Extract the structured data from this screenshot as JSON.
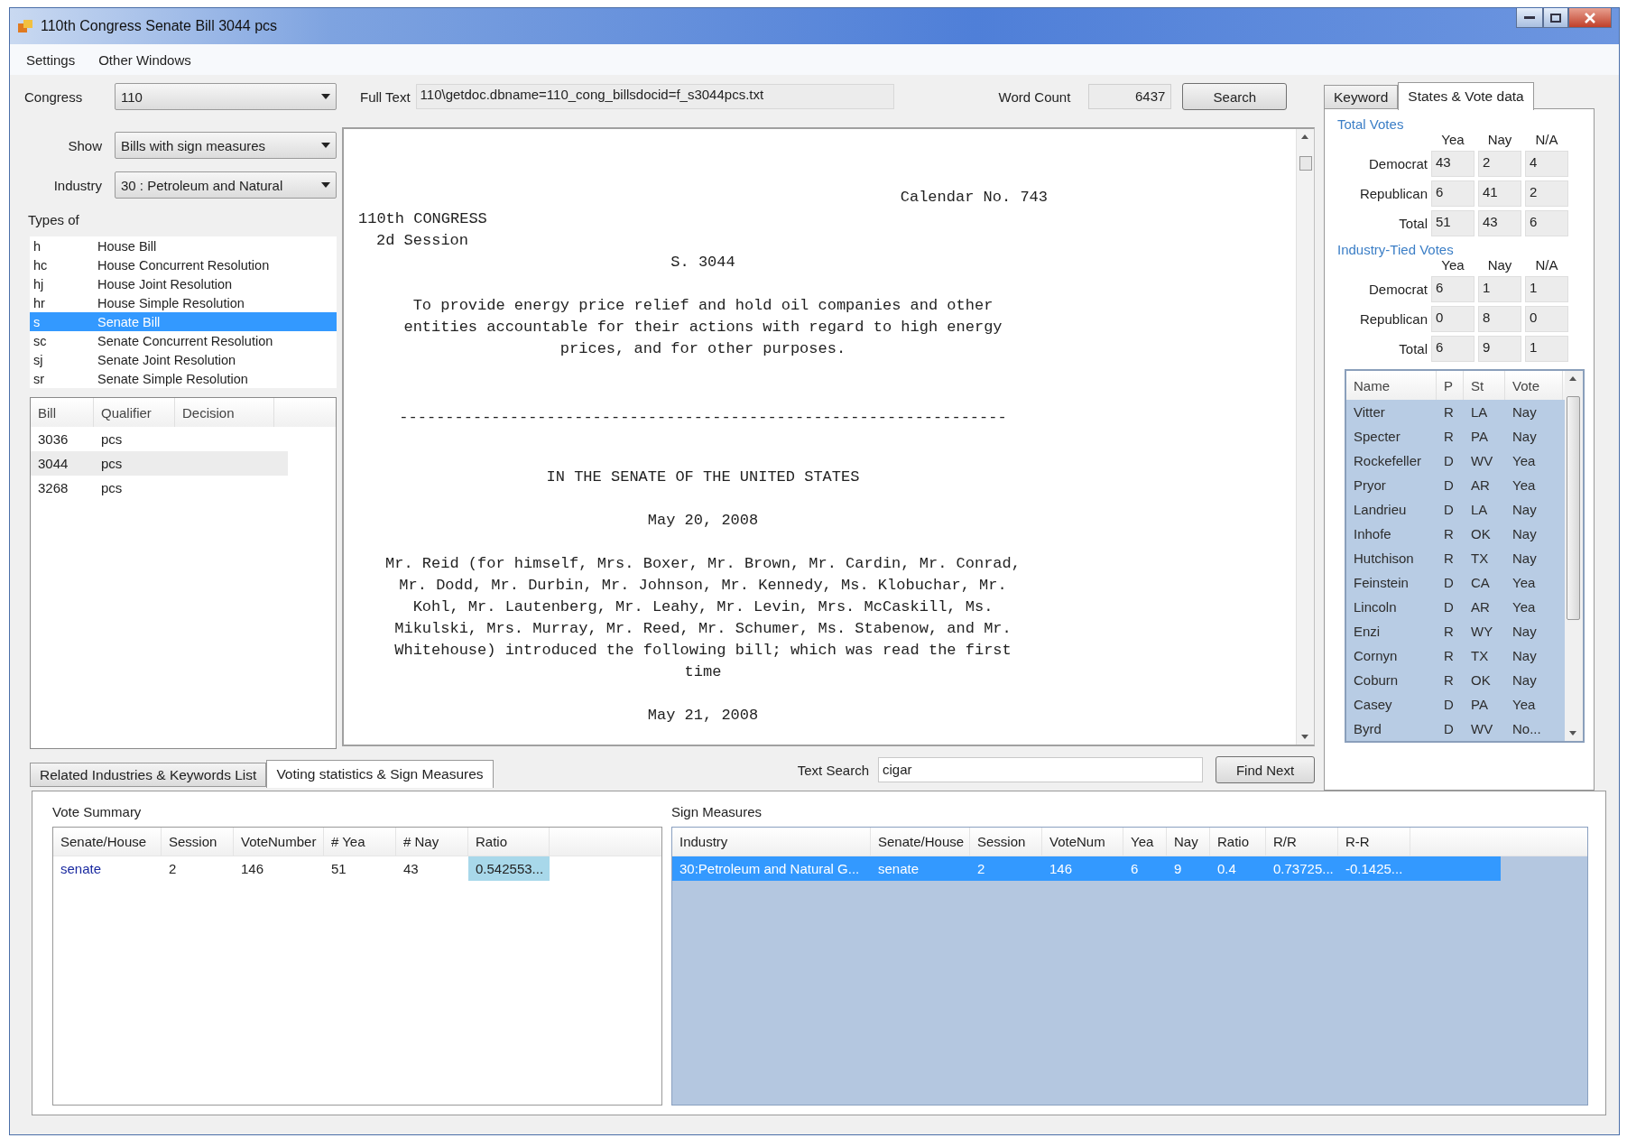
{
  "window": {
    "title": "110th Congress Senate Bill 3044 pcs"
  },
  "menu": [
    "Settings",
    "Other Windows"
  ],
  "filters": [
    {
      "label": "Congress",
      "value": "110"
    },
    {
      "label": "Show",
      "value": "Bills with sign measures"
    },
    {
      "label": "Industry",
      "value": "30 : Petroleum and Natural"
    }
  ],
  "types": {
    "label": "Types of",
    "items": [
      {
        "code": "h",
        "name": "House Bill",
        "selected": false
      },
      {
        "code": "hc",
        "name": "House Concurrent Resolution",
        "selected": false
      },
      {
        "code": "hj",
        "name": "House Joint Resolution",
        "selected": false
      },
      {
        "code": "hr",
        "name": "House Simple Resolution",
        "selected": false
      },
      {
        "code": "s",
        "name": "Senate Bill",
        "selected": true
      },
      {
        "code": "sc",
        "name": "Senate Concurrent Resolution",
        "selected": false
      },
      {
        "code": "sj",
        "name": "Senate Joint Resolution",
        "selected": false
      },
      {
        "code": "sr",
        "name": "Senate Simple Resolution",
        "selected": false
      }
    ]
  },
  "bills": {
    "columns": [
      "Bill",
      "Qualifier",
      "Decision"
    ],
    "rows": [
      {
        "cells": [
          "3036",
          "pcs"
        ],
        "selected": false
      },
      {
        "cells": [
          "3044",
          "pcs"
        ],
        "selected": true
      },
      {
        "cells": [
          "3268",
          "pcs"
        ],
        "selected": false
      }
    ]
  },
  "full_text": {
    "label": "Full Text",
    "value": "110\\getdoc.dbname=110_cong_billsdocid=f_s3044pcs.txt",
    "word_count_label": "Word Count",
    "word_count": "6437",
    "search_button": "Search"
  },
  "document": {
    "calendar": "Calendar No. 743",
    "congress": "110th CONGRESS",
    "session": "2d Session",
    "bill_number": "S. 3044",
    "title_lines": [
      "To provide energy price relief and hold oil companies and other",
      "entities accountable for their actions with regard to high energy",
      "prices, and for other purposes."
    ],
    "rule": "------------------------------------------------------------------",
    "chamber": "IN THE SENATE OF THE UNITED STATES",
    "date": "May 20, 2008",
    "sponsor_lines": [
      "Mr. Reid (for himself, Mrs. Boxer, Mr. Brown, Mr. Cardin, Mr. Conrad,",
      "Mr. Dodd, Mr. Durbin, Mr. Johnson, Mr. Kennedy, Ms. Klobuchar, Mr.",
      "Kohl, Mr. Lautenberg, Mr. Leahy, Mr. Levin, Mrs. McCaskill, Ms.",
      "Mikulski, Mrs. Murray, Mr. Reed, Mr. Schumer, Ms. Stabenow, and Mr.",
      "Whitehouse) introduced the following bill; which was read the first",
      "time"
    ],
    "date_2": "May 21, 2008"
  },
  "text_search": {
    "label": "Text Search",
    "value": "cigar",
    "button": "Find Next"
  },
  "right_tabs": [
    {
      "label": "Keyword",
      "selected": false
    },
    {
      "label": "States & Vote data",
      "selected": true
    }
  ],
  "vote_groups": [
    {
      "title": "Total Votes",
      "columns": [
        "Yea",
        "Nay",
        "N/A"
      ],
      "rows": [
        {
          "label": "Democrat",
          "values": [
            "43",
            "2",
            "4"
          ]
        },
        {
          "label": "Republican",
          "values": [
            "6",
            "41",
            "2"
          ]
        },
        {
          "label": "Total",
          "values": [
            "51",
            "43",
            "6"
          ]
        }
      ]
    },
    {
      "title": "Industry-Tied Votes",
      "columns": [
        "Yea",
        "Nay",
        "N/A"
      ],
      "rows": [
        {
          "label": "Democrat",
          "values": [
            "6",
            "1",
            "1"
          ]
        },
        {
          "label": "Republican",
          "values": [
            "0",
            "8",
            "0"
          ]
        },
        {
          "label": "Total",
          "values": [
            "6",
            "9",
            "1"
          ]
        }
      ]
    }
  ],
  "senators": {
    "columns": [
      "Name",
      "P",
      "St",
      "Vote"
    ],
    "rows": [
      [
        "Vitter",
        "R",
        "LA",
        "Nay"
      ],
      [
        "Specter",
        "R",
        "PA",
        "Nay"
      ],
      [
        "Rockefeller",
        "D",
        "WV",
        "Yea"
      ],
      [
        "Pryor",
        "D",
        "AR",
        "Yea"
      ],
      [
        "Landrieu",
        "D",
        "LA",
        "Nay"
      ],
      [
        "Inhofe",
        "R",
        "OK",
        "Nay"
      ],
      [
        "Hutchison",
        "R",
        "TX",
        "Nay"
      ],
      [
        "Feinstein",
        "D",
        "CA",
        "Yea"
      ],
      [
        "Lincoln",
        "D",
        "AR",
        "Yea"
      ],
      [
        "Enzi",
        "R",
        "WY",
        "Nay"
      ],
      [
        "Cornyn",
        "R",
        "TX",
        "Nay"
      ],
      [
        "Coburn",
        "R",
        "OK",
        "Nay"
      ],
      [
        "Casey",
        "D",
        "PA",
        "Yea"
      ],
      [
        "Byrd",
        "D",
        "WV",
        "No..."
      ]
    ]
  },
  "bottom_tabs": [
    {
      "label": "Related Industries & Keywords List",
      "selected": false
    },
    {
      "label": "Voting statistics & Sign Measures",
      "selected": true
    }
  ],
  "vote_summary": {
    "title": "Vote Summary",
    "columns": [
      "Senate/House",
      "Session",
      "VoteNumber",
      "# Yea",
      "# Nay",
      "Ratio"
    ],
    "rows": [
      {
        "cells": [
          "senate",
          "2",
          "146",
          "51",
          "43",
          "0.542553..."
        ],
        "selected": true
      }
    ]
  },
  "sign_measures": {
    "title": "Sign Measures",
    "columns": [
      "Industry",
      "Senate/House",
      "Session",
      "VoteNum",
      "Yea",
      "Nay",
      "Ratio",
      "R/R",
      "R-R"
    ],
    "rows": [
      {
        "cells": [
          "30:Petroleum and Natural G...",
          "senate",
          "2",
          "146",
          "6",
          "9",
          "0.4",
          "0.73725...",
          "-0.1425..."
        ],
        "selected": true
      }
    ]
  }
}
